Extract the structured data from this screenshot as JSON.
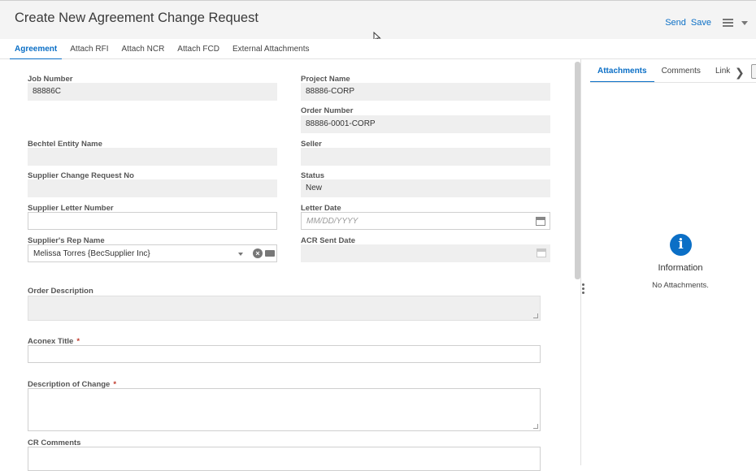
{
  "header": {
    "title": "Create New Agreement Change Request",
    "send_label": "Send",
    "save_label": "Save"
  },
  "tabs": [
    {
      "label": "Agreement",
      "active": true
    },
    {
      "label": "Attach RFI",
      "active": false
    },
    {
      "label": "Attach NCR",
      "active": false
    },
    {
      "label": "Attach FCD",
      "active": false
    },
    {
      "label": "External Attachments",
      "active": false
    }
  ],
  "form": {
    "job_number": {
      "label": "Job Number",
      "value": "88886C"
    },
    "project_name": {
      "label": "Project Name",
      "value": "88886-CORP"
    },
    "order_number": {
      "label": "Order Number",
      "value": "88886-0001-CORP"
    },
    "bechtel_entity_name": {
      "label": "Bechtel Entity Name",
      "value": ""
    },
    "seller": {
      "label": "Seller",
      "value": ""
    },
    "supplier_change_request_no": {
      "label": "Supplier Change Request No",
      "value": ""
    },
    "status": {
      "label": "Status",
      "value": "New"
    },
    "supplier_letter_number": {
      "label": "Supplier Letter Number",
      "value": ""
    },
    "letter_date": {
      "label": "Letter Date",
      "placeholder": "MM/DD/YYYY"
    },
    "suppliers_rep_name": {
      "label": "Supplier's Rep Name",
      "value": "Melissa Torres {BecSupplier Inc}"
    },
    "acr_sent_date": {
      "label": "ACR Sent Date",
      "value": ""
    },
    "order_description": {
      "label": "Order Description",
      "value": ""
    },
    "aconex_title": {
      "label": "Aconex Title",
      "required": "*",
      "value": ""
    },
    "description_of_change": {
      "label": "Description of Change",
      "required": "*",
      "value": ""
    },
    "cr_comments": {
      "label": "CR Comments",
      "value": ""
    }
  },
  "side_panel": {
    "tabs": [
      {
        "label": "Attachments",
        "active": true
      },
      {
        "label": "Comments",
        "active": false
      },
      {
        "label": "Link",
        "active": false
      }
    ],
    "info_icon_glyph": "i",
    "info_title": "Information",
    "info_message": "No Attachments."
  },
  "colors": {
    "accent": "#0b6fc6",
    "readonly_field": "#efefef",
    "required_marker": "#c0392b"
  }
}
